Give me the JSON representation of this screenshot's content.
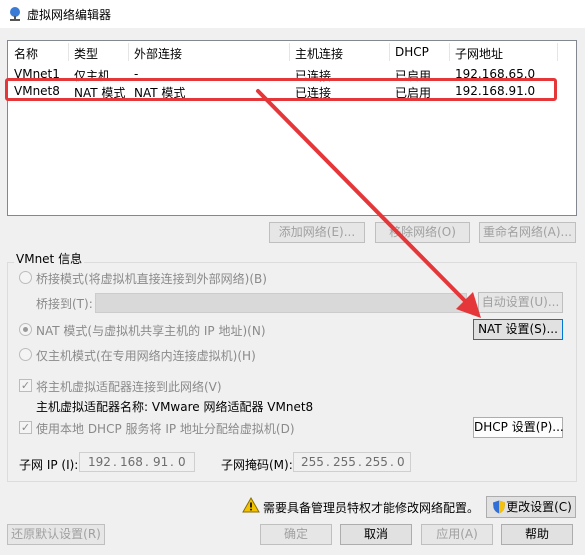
{
  "window": {
    "title": "虚拟网络编辑器"
  },
  "table": {
    "headers": [
      "名称",
      "类型",
      "外部连接",
      "主机连接",
      "DHCP",
      "子网地址"
    ],
    "rows": [
      [
        "VMnet1",
        "仅主机...",
        "-",
        "已连接",
        "已启用",
        "192.168.65.0"
      ],
      [
        "VMnet8",
        "NAT 模式",
        "NAT 模式",
        "已连接",
        "已启用",
        "192.168.91.0"
      ]
    ]
  },
  "list_buttons": {
    "add": "添加网络(E)...",
    "remove": "移除网络(O)",
    "rename": "重命名网络(A)..."
  },
  "vmnet_info": {
    "title": "VMnet 信息",
    "bridge_mode": "桥接模式(将虚拟机直接连接到外部网络)(B)",
    "bridge_to_label": "桥接到(T):",
    "auto_settings": "自动设置(U)...",
    "nat_mode": "NAT 模式(与虚拟机共享主机的 IP 地址)(N)",
    "nat_settings": "NAT 设置(S)...",
    "host_only_mode": "仅主机模式(在专用网络内连接虚拟机)(H)",
    "connect_adapter": "将主机虚拟适配器连接到此网络(V)",
    "adapter_name": "主机虚拟适配器名称: VMware 网络适配器 VMnet8",
    "use_dhcp": "使用本地 DHCP 服务将 IP 地址分配给虚拟机(D)",
    "dhcp_settings": "DHCP 设置(P)...",
    "subnet_ip_label": "子网 IP (I):",
    "subnet_ip": [
      "192",
      "168",
      "91",
      "0"
    ],
    "subnet_mask_label": "子网掩码(M):",
    "subnet_mask": [
      "255",
      "255",
      "255",
      "0"
    ]
  },
  "admin_notice": "需要具备管理员特权才能修改网络配置。",
  "bottom_buttons": {
    "change_settings": "更改设置(C)",
    "restore_defaults": "还原默认设置(R)",
    "ok": "确定",
    "cancel": "取消",
    "apply": "应用(A)",
    "help": "帮助"
  },
  "colors": {
    "annotation_red": "#e5373a",
    "selection_blue": "#0078d7"
  }
}
